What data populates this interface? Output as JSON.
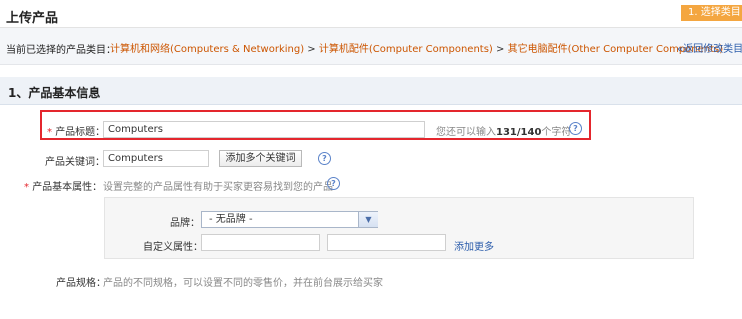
{
  "header": {
    "title": "上传产品",
    "step_badge": "1. 选择类目"
  },
  "category": {
    "label": "当前已选择的产品类目：",
    "path": [
      "计算机和网络(Computers & Networking)",
      "计算机配件(Computer Components)",
      "其它电脑配件(Other Computer Components)"
    ],
    "separator": ">",
    "back_link": "«返回修改类目"
  },
  "section": {
    "title": "1、产品基本信息"
  },
  "form": {
    "required_mark": "*",
    "product_title": {
      "label": "产品标题：",
      "value": "Computers",
      "hint_prefix": "您还可以输入",
      "count": "131/140",
      "hint_suffix": "个字符"
    },
    "keywords": {
      "label": "产品关键词：",
      "value": "Computers",
      "add_button": "添加多个关键词"
    },
    "attributes": {
      "label": "产品基本属性：",
      "hint": "设置完整的产品属性有助于买家更容易找到您的产品",
      "brand_label": "品牌：",
      "brand_selected": "- 无品牌 -",
      "custom_label": "自定义属性：",
      "custom_name_value": "",
      "custom_value_value": "",
      "add_more_link": "添加更多"
    },
    "specs": {
      "label": "产品规格：",
      "hint": "产品的不同规格，可以设置不同的零售价，并在前台展示给买家"
    }
  },
  "icons": {
    "help": "?",
    "dropdown": "▼"
  },
  "colors": {
    "accent_orange": "#f4a640",
    "link_blue": "#2b5cab",
    "category_orange": "#cc5500",
    "required_red": "#e4262d"
  }
}
